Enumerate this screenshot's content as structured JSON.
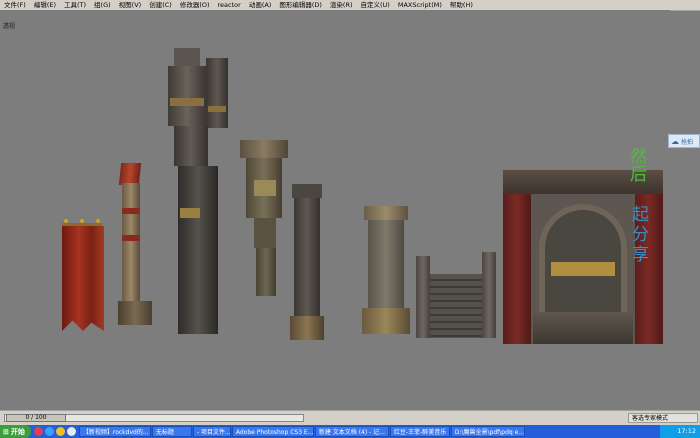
{
  "menu": [
    "文件(F)",
    "编辑(E)",
    "工具(T)",
    "组(G)",
    "视图(V)",
    "创建(C)",
    "修改器(O)",
    "reactor",
    "动画(A)",
    "图形编辑器(D)",
    "渲染(R)",
    "自定义(U)",
    "MAXScript(M)",
    "帮助(H)"
  ],
  "viewport": {
    "label": "透视"
  },
  "side_tab": {
    "icon": "share-icon",
    "label": "抢拍"
  },
  "overlay_text": [
    "然",
    "后",
    "起",
    "分",
    "享"
  ],
  "timeline": {
    "frame": "0 / 100"
  },
  "status": {
    "mode_text": "客选专家模式"
  },
  "taskbar": {
    "start_label": "开始",
    "buttons": [
      "【新视频】rockdvd的...",
      "无标题",
      "- 项目文件...",
      "Adobe Photoshop CS3 E...",
      "新建 文本文档 (4) - 记...",
      "红豆-王菲-醉美音乐",
      "D:\\魔兽全景\\pdf\\pdq e..."
    ],
    "time": "17:12"
  },
  "colors": {
    "viewport_bg": "#7d7d7d",
    "taskbar": "#245edb",
    "overlay_green": "#4fbf3a",
    "overlay_blue": "#3b8fc4"
  }
}
